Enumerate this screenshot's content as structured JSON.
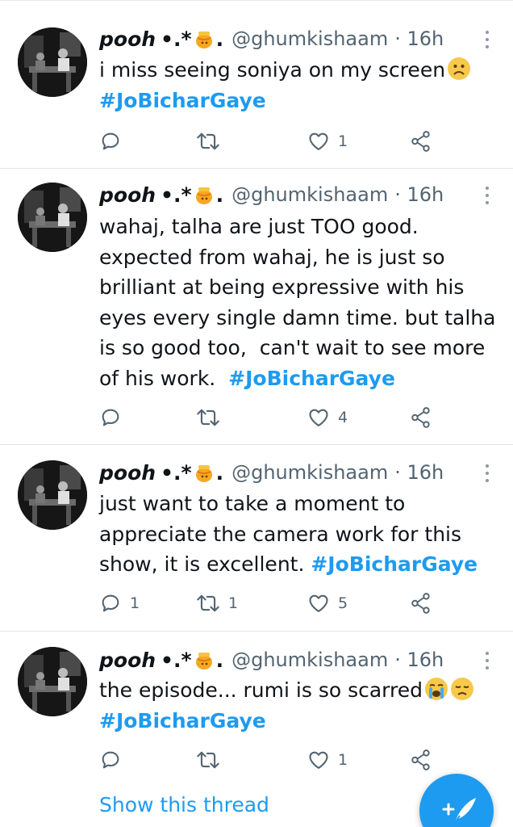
{
  "tweets": [
    {
      "display_name": "pooh",
      "name_deco": "•.*",
      "name_tail": ".",
      "handle": "@ghumkishaam",
      "time": "· 16h",
      "text": "i miss seeing soniya on my screen",
      "trailing_emoji": "slightly-frowning-face",
      "hashtag": "#JoBicharGaye",
      "replies": "",
      "retweets": "",
      "likes": "1"
    },
    {
      "display_name": "pooh",
      "name_deco": "•.*",
      "name_tail": ".",
      "handle": "@ghumkishaam",
      "time": "· 16h",
      "text": "wahaj, talha are just TOO good.\nexpected from wahaj, he is just so\nbrilliant at being expressive with his\neyes every single damn time. but talha\nis so good too,  can't wait to see more\nof his work.  ",
      "hashtag": "#JoBicharGaye",
      "replies": "",
      "retweets": "",
      "likes": "4"
    },
    {
      "display_name": "pooh",
      "name_deco": "•.*",
      "name_tail": ".",
      "handle": "@ghumkishaam",
      "time": "· 16h",
      "text": "just want to take a moment to\nappreciate the camera work for this\nshow, it is excellent. ",
      "hashtag": "#JoBicharGaye",
      "replies": "1",
      "retweets": "1",
      "likes": "5"
    },
    {
      "display_name": "pooh",
      "name_deco": "•.*",
      "name_tail": ".",
      "handle": "@ghumkishaam",
      "time": "· 16h",
      "text": "the episode... rumi is so scarred",
      "trailing_emoji": "crying-face, disappointed-face",
      "hashtag": "#JoBicharGaye",
      "replies": "",
      "retweets": "",
      "likes": "1"
    }
  ],
  "show_thread": "Show this thread",
  "colors": {
    "accent": "#1d9bf0",
    "text": "#0f1419",
    "secondary": "#536471",
    "divider": "#e2e5e7"
  },
  "icons": {
    "reply": "reply-icon",
    "retweet": "retweet-icon",
    "like": "heart-icon",
    "share": "share-icon",
    "more": "more-icon",
    "compose": "compose-tweet-icon"
  }
}
